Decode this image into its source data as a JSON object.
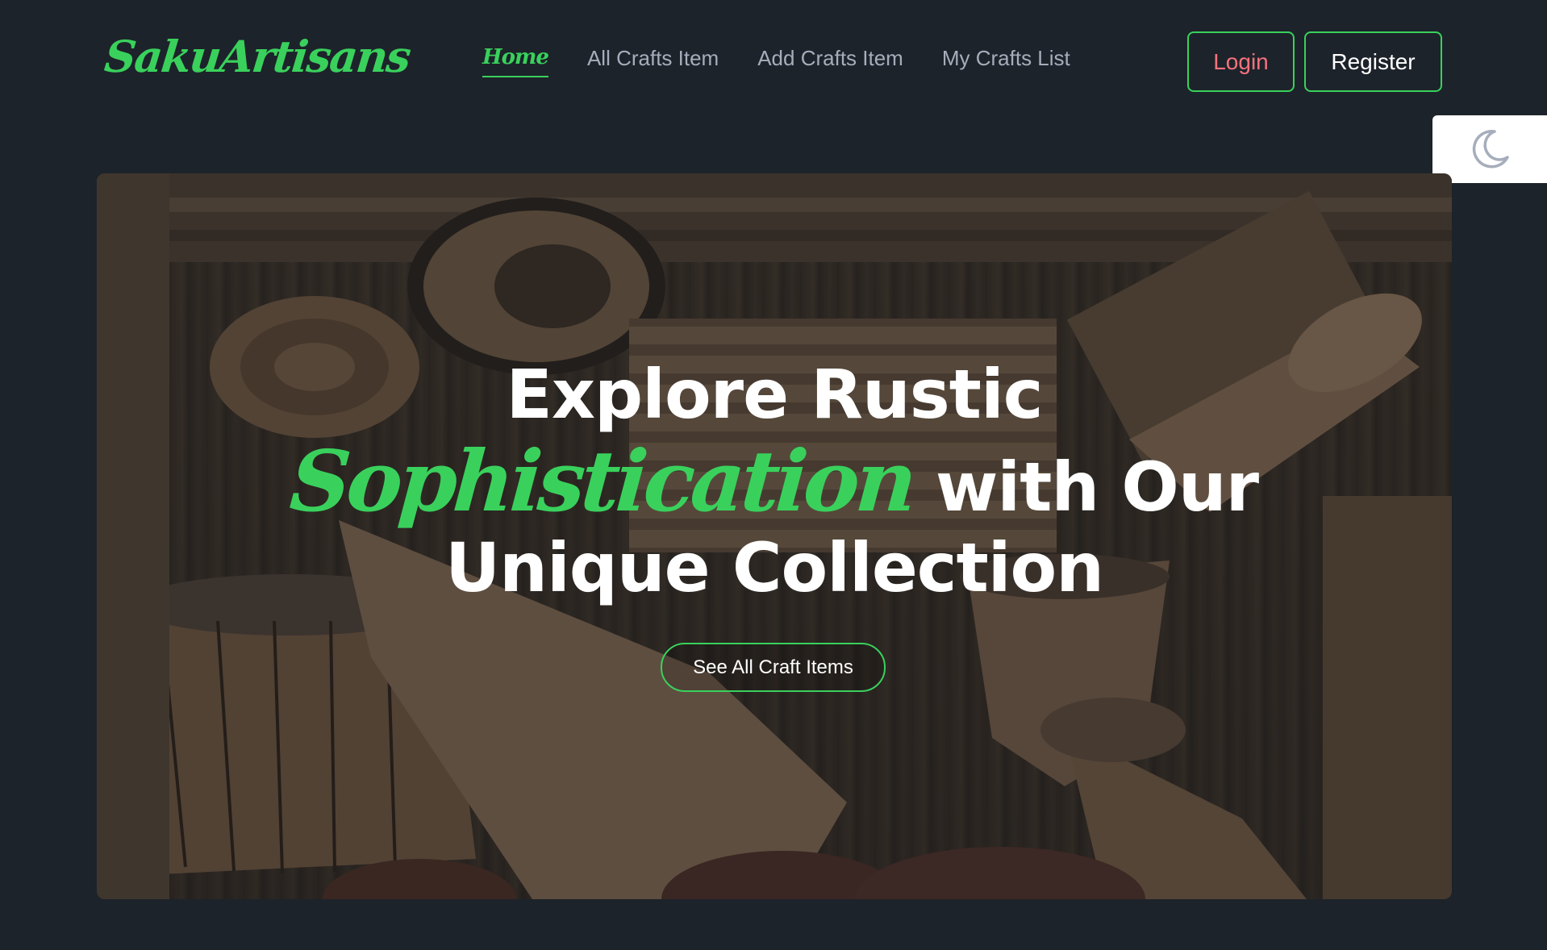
{
  "brand": {
    "logo_text": "SakuArtisans"
  },
  "nav": {
    "items": [
      {
        "label": "Home",
        "active": true
      },
      {
        "label": "All Crafts Item",
        "active": false
      },
      {
        "label": "Add Crafts Item",
        "active": false
      },
      {
        "label": "My Crafts List",
        "active": false
      }
    ]
  },
  "auth": {
    "login_label": "Login",
    "register_label": "Register"
  },
  "theme_toggle": {
    "icon": "moon-icon"
  },
  "hero": {
    "title_line1": "Explore Rustic",
    "title_highlight": "Sophistication",
    "title_line2_rest": "with Our",
    "title_line3": "Unique Collection",
    "cta_label": "See All Craft Items",
    "background": "handcrafted wooden drums and instruments"
  },
  "colors": {
    "background": "#1d232a",
    "accent": "#39d15c",
    "login_text": "#f8727d",
    "nav_text": "#a6adbb",
    "white": "#ffffff"
  }
}
